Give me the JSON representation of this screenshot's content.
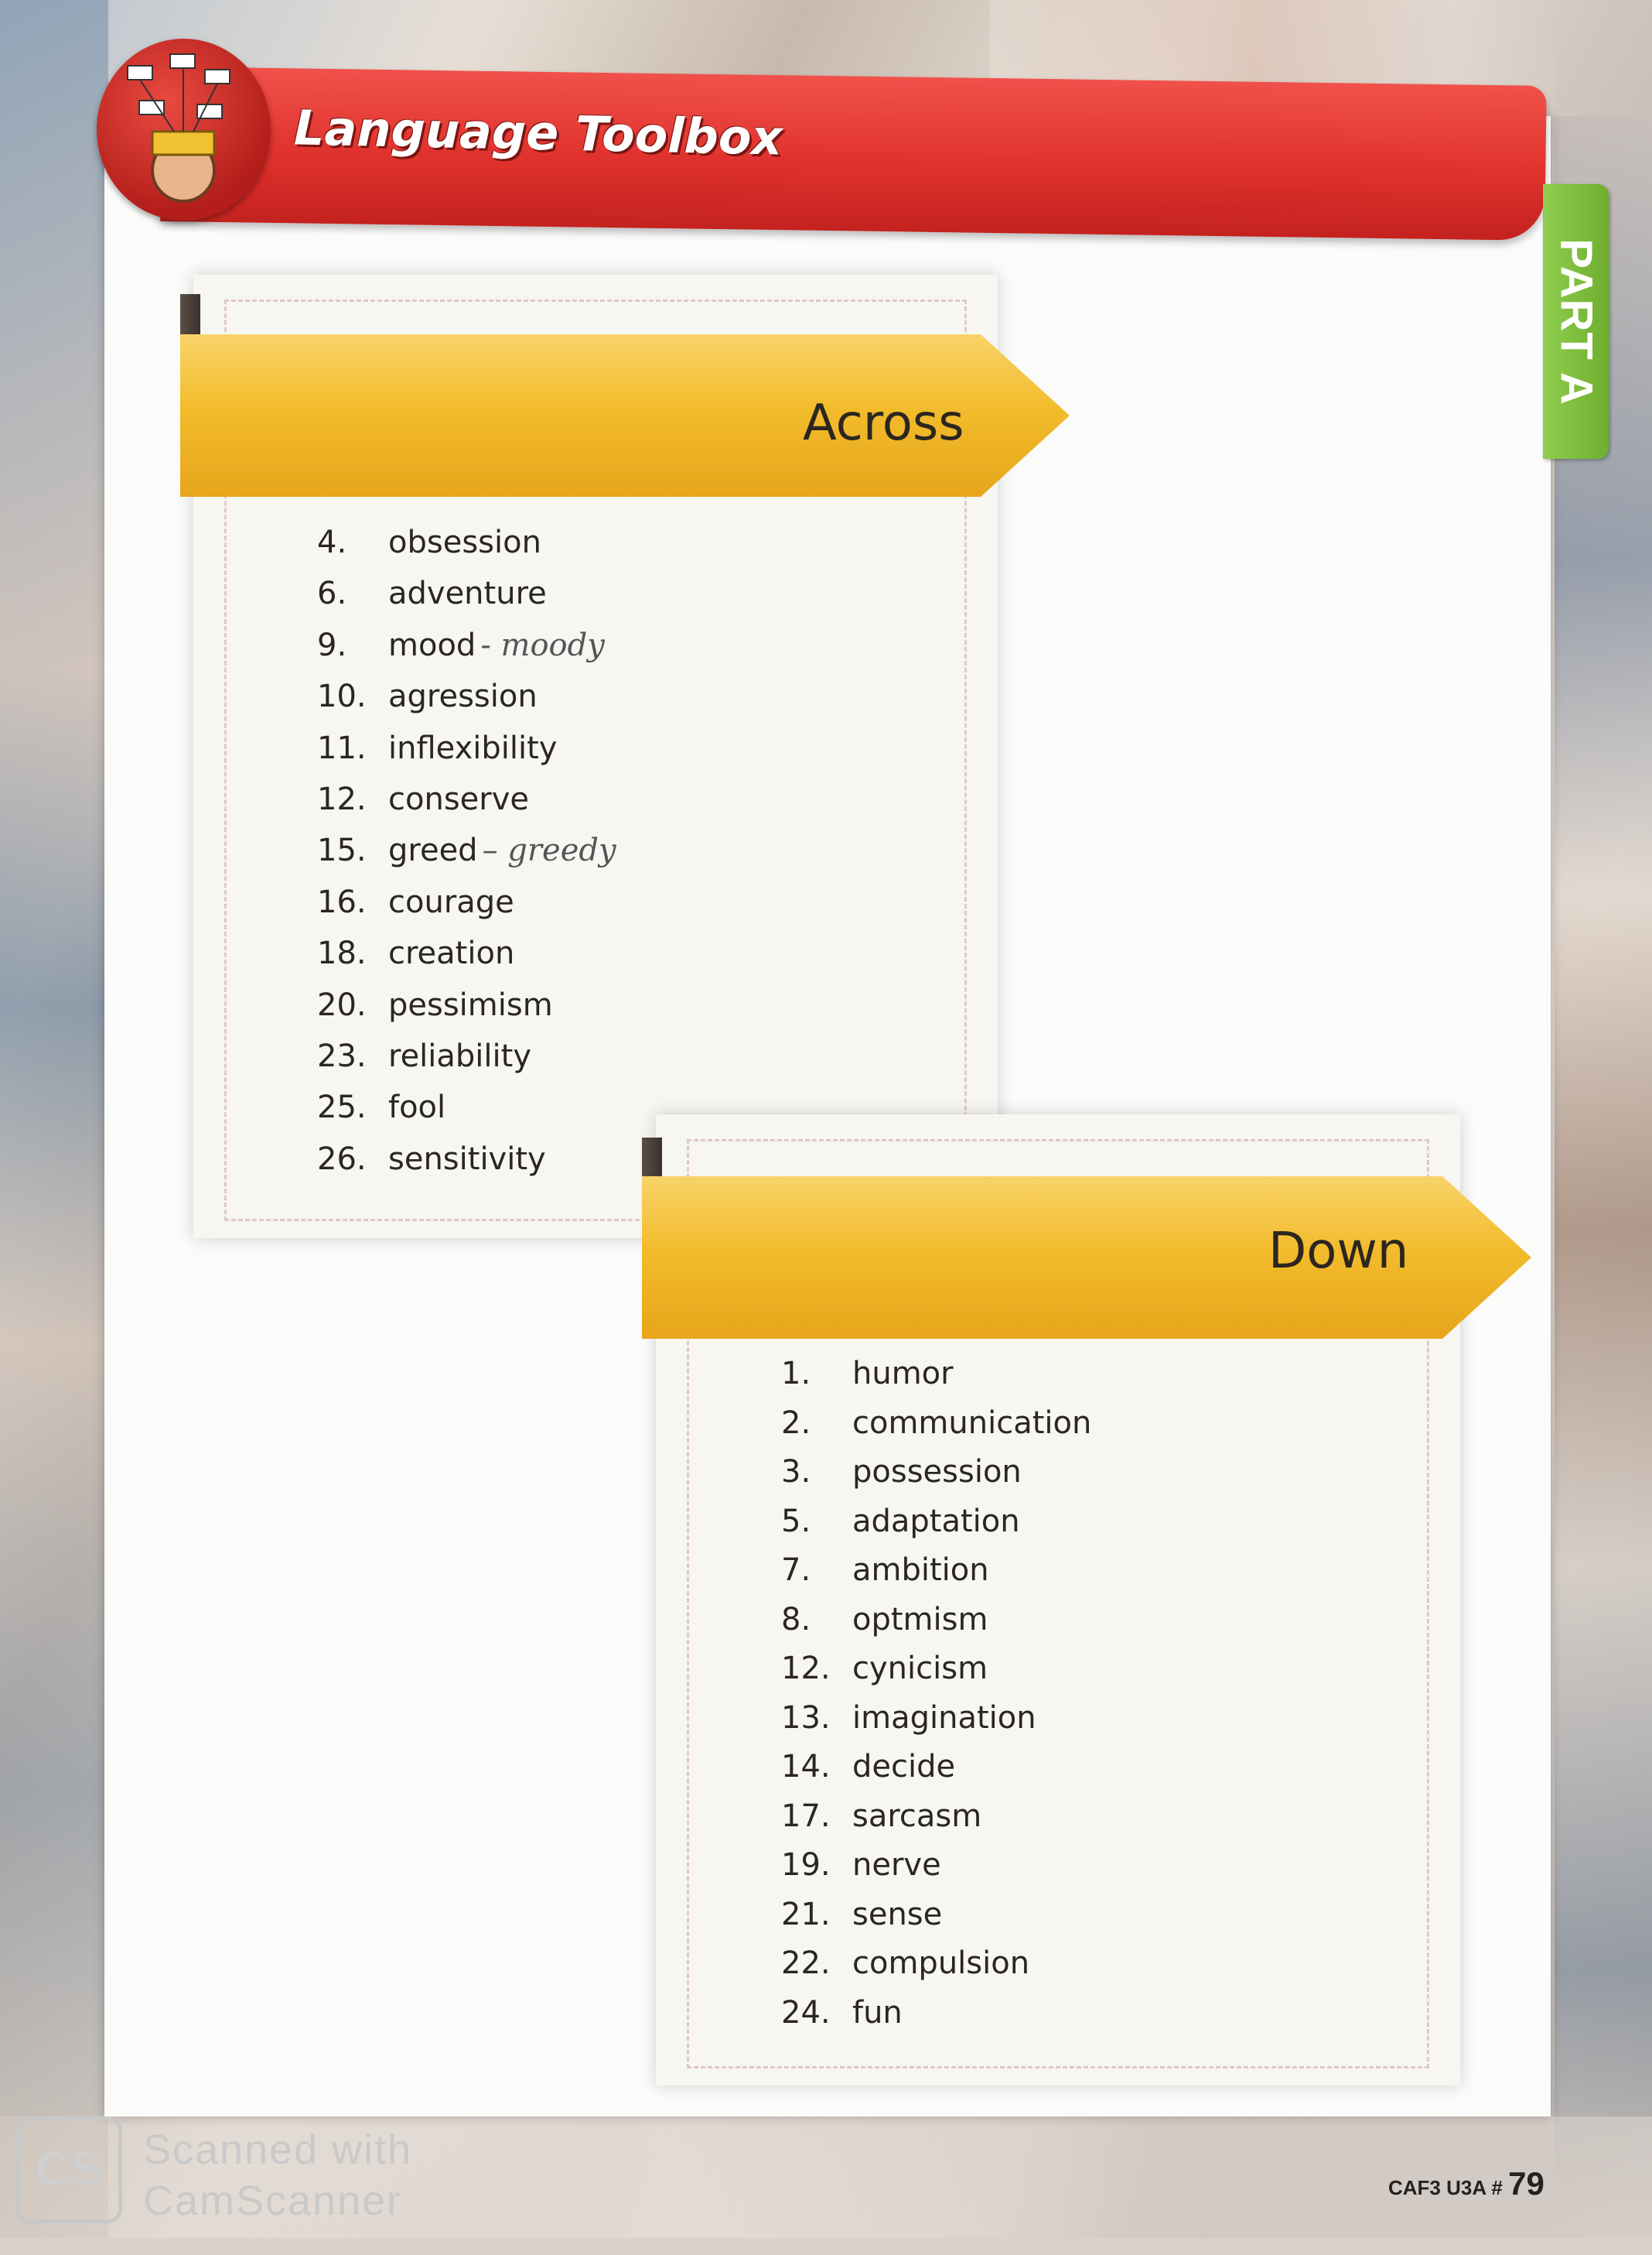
{
  "header": {
    "title": "Language Toolbox",
    "tab": "PART A"
  },
  "across": {
    "heading": "Across",
    "items": [
      {
        "num": "4.",
        "word": "obsession",
        "note": ""
      },
      {
        "num": "6.",
        "word": "adventure",
        "note": ""
      },
      {
        "num": "9.",
        "word": "mood",
        "note": "- moody"
      },
      {
        "num": "10.",
        "word": "agression",
        "note": ""
      },
      {
        "num": "11.",
        "word": "inflexibility",
        "note": ""
      },
      {
        "num": "12.",
        "word": "conserve",
        "note": ""
      },
      {
        "num": "15.",
        "word": "greed",
        "note": "– greedy"
      },
      {
        "num": "16.",
        "word": "courage",
        "note": ""
      },
      {
        "num": "18.",
        "word": "creation",
        "note": ""
      },
      {
        "num": "20.",
        "word": "pessimism",
        "note": ""
      },
      {
        "num": "23.",
        "word": "reliability",
        "note": ""
      },
      {
        "num": "25.",
        "word": "fool",
        "note": ""
      },
      {
        "num": "26.",
        "word": "sensitivity",
        "note": ""
      }
    ]
  },
  "down": {
    "heading": "Down",
    "items": [
      {
        "num": "1.",
        "word": "humor"
      },
      {
        "num": "2.",
        "word": "communication"
      },
      {
        "num": "3.",
        "word": "possession"
      },
      {
        "num": "5.",
        "word": "adaptation"
      },
      {
        "num": "7.",
        "word": "ambition"
      },
      {
        "num": "8.",
        "word": "optmism"
      },
      {
        "num": "12.",
        "word": "cynicism"
      },
      {
        "num": "13.",
        "word": "imagination"
      },
      {
        "num": "14.",
        "word": "decide"
      },
      {
        "num": "17.",
        "word": "sarcasm"
      },
      {
        "num": "19.",
        "word": "nerve"
      },
      {
        "num": "21.",
        "word": "sense"
      },
      {
        "num": "22.",
        "word": "compulsion"
      },
      {
        "num": "24.",
        "word": "fun"
      }
    ]
  },
  "footer": {
    "code": "CAF3 U3A #",
    "page": "79"
  },
  "watermark": {
    "logo": "CS",
    "line1": "Scanned with",
    "line2": "CamScanner"
  }
}
